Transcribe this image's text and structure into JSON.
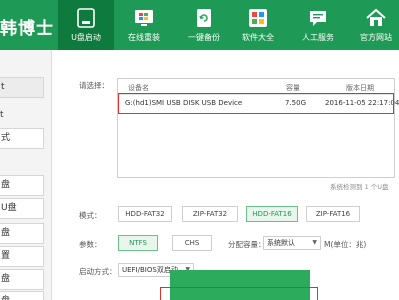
{
  "app": {
    "logo_text": "韩博士",
    "brand_color": "#1e9a56"
  },
  "nav": [
    {
      "label": "U盘启动",
      "icon": "usb-drive-icon",
      "active": true
    },
    {
      "label": "在线重装",
      "icon": "monitor-windows-icon",
      "active": false
    },
    {
      "label": "一键备份",
      "icon": "backup-refresh-icon",
      "active": false
    },
    {
      "label": "软件大全",
      "icon": "app-grid-icon",
      "active": false
    },
    {
      "label": "人工服务",
      "icon": "chat-bubble-icon",
      "active": false
    },
    {
      "label": "官方网站",
      "icon": "home-icon",
      "active": false
    }
  ],
  "sidebar": {
    "items": [
      "t",
      "t",
      "式",
      "",
      "盘",
      "U盘",
      "盘",
      "置",
      "盘",
      "盘"
    ]
  },
  "device": {
    "select_label": "请选择：",
    "col_device": "设备名",
    "col_capacity": "容量",
    "col_date": "版本日期",
    "row": {
      "name": "G:(hd1)SMI USB DISK USB Device",
      "capacity": "7.50G",
      "date": "2016-11-05 22:17:04"
    },
    "status": "系统检测到 1 个U盘"
  },
  "mode": {
    "label": "模式：",
    "options": [
      "HDD-FAT32",
      "ZIP-FAT32",
      "HDD-FAT16",
      "ZIP-FAT16"
    ],
    "selected": "HDD-FAT16"
  },
  "params": {
    "label": "参数：",
    "fs_options": [
      "NTFS",
      "CHS"
    ],
    "fs_selected": "NTFS",
    "alloc_label": "分配容量：",
    "alloc_value": "系统默认",
    "unit_label": "M(单位：兆)"
  },
  "boot": {
    "label": "启动方式：",
    "value": "UEFI/BIOS双启动"
  }
}
